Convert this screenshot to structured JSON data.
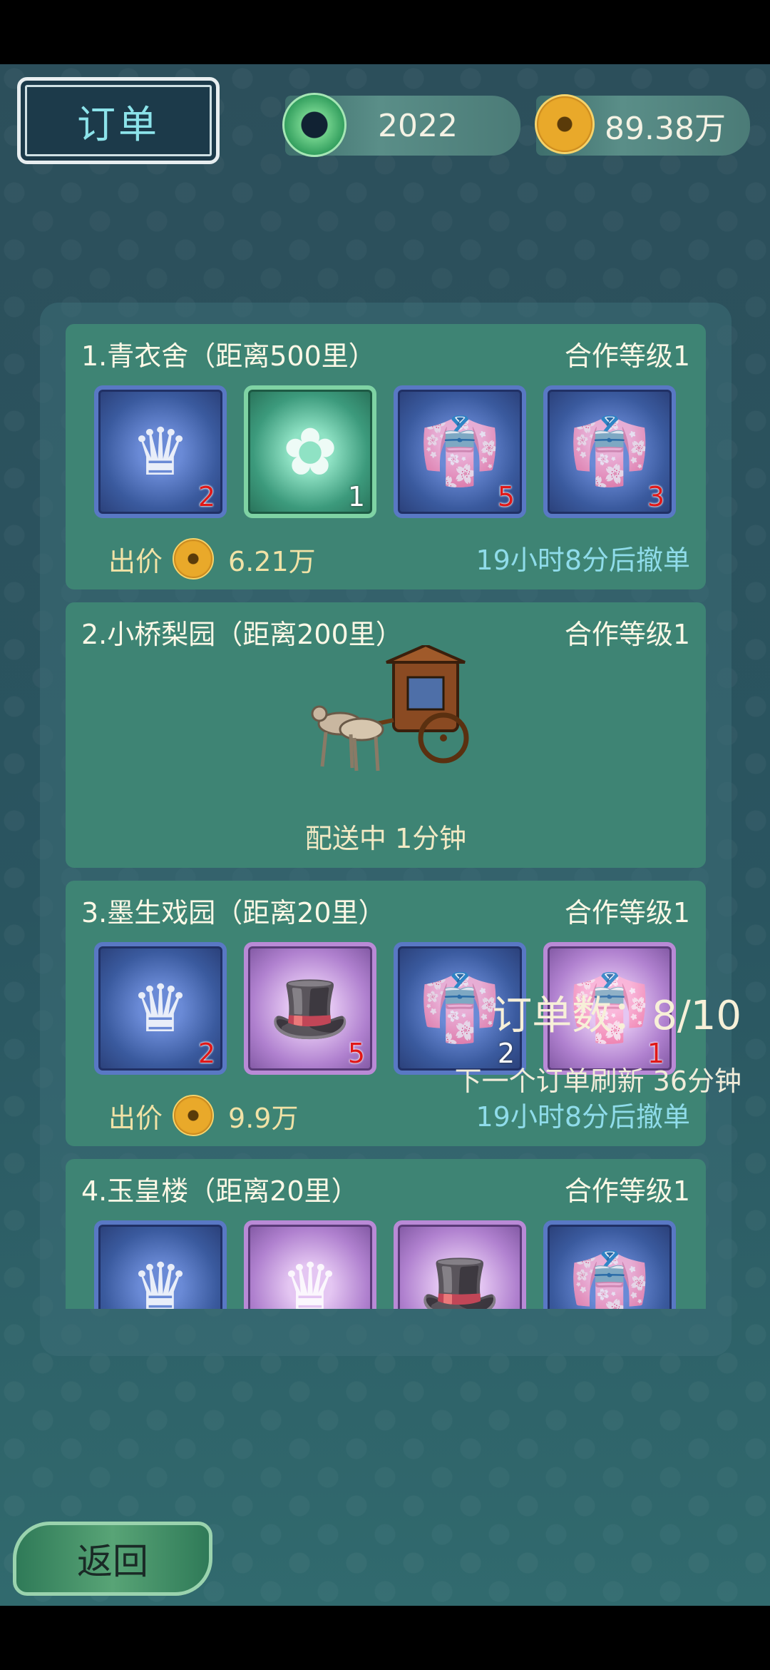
{
  "header": {
    "title": "订单",
    "jade_value": "2022",
    "coin_value": "89.38万"
  },
  "orders": [
    {
      "name": "1.青衣舍（距离500里）",
      "coop": "合作等级1",
      "items": [
        {
          "icon": "headdress-icon",
          "count": "2",
          "rarity": "blue"
        },
        {
          "icon": "hairpin-icon",
          "count": "1",
          "rarity": "green"
        },
        {
          "icon": "robe-icon",
          "count": "5",
          "rarity": "blue"
        },
        {
          "icon": "robe-icon",
          "count": "3",
          "rarity": "blue"
        }
      ],
      "price_label": "出价",
      "price": "6.21万",
      "timer": "19小时8分后撤单"
    },
    {
      "name": "2.小桥梨园（距离200里）",
      "coop": "合作等级1",
      "status": "配送中 1分钟"
    },
    {
      "name": "3.墨生戏园（距离20里）",
      "coop": "合作等级1",
      "items": [
        {
          "icon": "headdress-icon",
          "count": "2",
          "rarity": "blue"
        },
        {
          "icon": "hat-icon",
          "count": "5",
          "rarity": "purple"
        },
        {
          "icon": "robe-icon",
          "count": "2",
          "rarity": "blue"
        },
        {
          "icon": "robe-icon",
          "count": "1",
          "rarity": "purple"
        }
      ],
      "price_label": "出价",
      "price": "9.9万",
      "timer": "19小时8分后撤单"
    },
    {
      "name": "4.玉皇楼（距离20里）",
      "coop": "合作等级1",
      "items": [
        {
          "icon": "headdress-icon",
          "rarity": "blue"
        },
        {
          "icon": "headdress-icon",
          "rarity": "purple"
        },
        {
          "icon": "hat-icon",
          "rarity": "purple"
        },
        {
          "icon": "robe-icon",
          "rarity": "blue"
        }
      ]
    }
  ],
  "footer": {
    "order_count": "订单数：8/10",
    "refresh": "下一个订单刷新 36分钟"
  },
  "back_label": "返回"
}
